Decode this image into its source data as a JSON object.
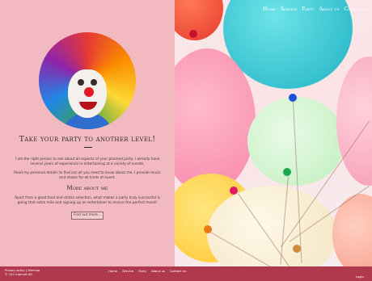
{
  "nav": {
    "items": [
      "Home",
      "Service",
      "Party",
      "About us",
      "Contact us"
    ]
  },
  "hero": {
    "headline": "Take your party to another level!",
    "intro": "I am the right person to ask about all aspects of your planned party. I already have several years of experience in entertaining at a variety of events.",
    "details": "Read my personal details to find out all you need to know about me. I provide music and shows for all kinds of event.",
    "more_heading": "More about me",
    "more_text": "Apart from a good food and drinks selection, what makes a party truly successful is going that extra mile and signing up an entertainer to ensure the perfect mood!",
    "cta_label": "Find out more..."
  },
  "footer": {
    "legal_links": "Privacy policy  |  Sitemap",
    "copyright": "© 1&1 Internet AG",
    "links": [
      "Home",
      "Service",
      "Party",
      "About us",
      "Contact us"
    ],
    "login": "Login"
  },
  "colors": {
    "accent": "#b1394e",
    "panel": "#f2b9c1"
  }
}
